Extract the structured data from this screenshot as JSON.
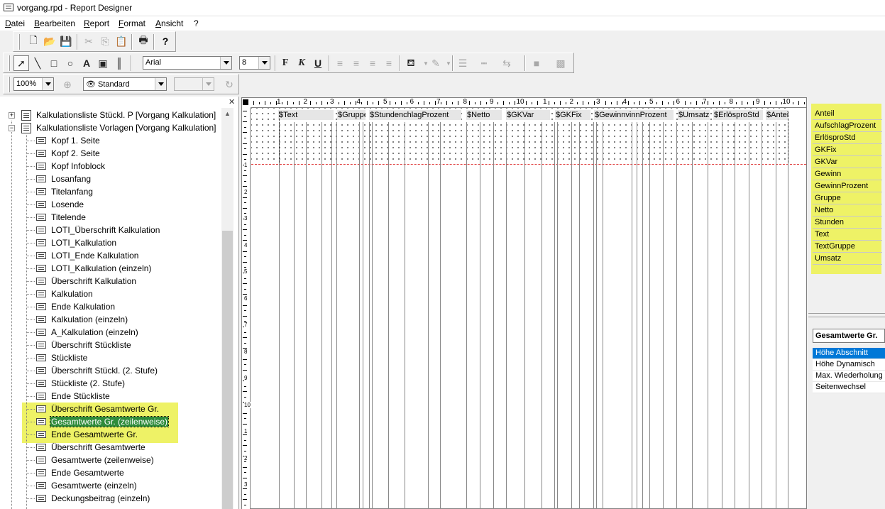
{
  "window": {
    "title": "vorgang.rpd - Report Designer"
  },
  "menu": [
    "Datei",
    "Bearbeiten",
    "Report",
    "Format",
    "Ansicht",
    "?"
  ],
  "toolbar_format": {
    "font": "Arial",
    "size": "8"
  },
  "toolbar_view": {
    "zoom": "100%",
    "style": "Standard",
    "third": ""
  },
  "tree": {
    "roots": [
      "Kalkulationsliste Stückl. P [Vorgang Kalkulation]",
      "Kalkulationsliste Vorlagen [Vorgang Kalkulation]"
    ],
    "items": [
      "Kopf 1. Seite",
      "Kopf 2. Seite",
      "Kopf Infoblock",
      "Losanfang",
      "Titelanfang",
      "Losende",
      "Titelende",
      "LOTI_Überschrift Kalkulation",
      "LOTI_Kalkulation",
      "LOTI_Ende Kalkulation",
      "LOTI_Kalkulation (einzeln)",
      "Überschrift Kalkulation",
      "Kalkulation",
      "Ende Kalkulation",
      "Kalkulation (einzeln)",
      "A_Kalkulation (einzeln)",
      "Überschrift Stückliste",
      "Stückliste",
      "Überschrift Stückl. (2. Stufe)",
      "Stückliste (2. Stufe)",
      "Ende Stückliste",
      "Überschrift Gesamtwerte Gr.",
      "Gesamtwerte Gr. (zeilenweise)",
      "Ende Gesamtwerte Gr.",
      "Überschrift Gesamtwerte",
      "Gesamtwerte (zeilenweise)",
      "Ende Gesamtwerte",
      "Gesamtwerte (einzeln)",
      "Deckungsbeitrag (einzeln)"
    ],
    "selected": "Gesamtwerte Gr. (zeilenweise)"
  },
  "ruler": {
    "h_numbers": [
      "1",
      "2",
      "3",
      "4",
      "5",
      "6",
      "7",
      "8",
      "9",
      "10",
      "1",
      "2",
      "3",
      "4",
      "5",
      "6",
      "7",
      "8",
      "9",
      "10"
    ],
    "v_numbers": [
      "1",
      "2",
      "3",
      "4",
      "5",
      "6",
      "7",
      "8",
      "9",
      "10",
      "1",
      "2",
      "3"
    ]
  },
  "fields": [
    "$Text",
    "$Gruppe",
    "$StundenchlagProzent",
    "$Netto",
    "$GKVar",
    "$GKFix",
    "$GewinnvinnProzent",
    "$Umsatz",
    "$ErlösproStd",
    "$Antei"
  ],
  "variables": [
    "Anteil",
    "AufschlagProzent",
    "ErlösproStd",
    "GKFix",
    "GKVar",
    "Gewinn",
    "GewinnProzent",
    "Gruppe",
    "Netto",
    "Stunden",
    "Text",
    "TextGruppe",
    "Umsatz"
  ],
  "properties": {
    "section": "Gesamtwerte Gr.",
    "items": [
      "Höhe Abschnitt",
      "Höhe Dynamisch",
      "Max. Wiederholung",
      "Seitenwechsel"
    ],
    "selected": "Höhe Abschnitt"
  },
  "colors": {
    "highlight": "#eef266",
    "selection": "#2e8b3a",
    "prop_selection": "#0078d7",
    "band_line": "#e04040"
  }
}
